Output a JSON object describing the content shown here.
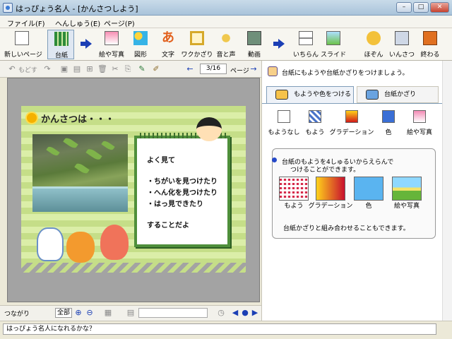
{
  "window": {
    "title": "はっぴょう名人 - [かんさつしよう]",
    "minimize": "–",
    "maximize": "□",
    "close": "✕"
  },
  "menu": [
    "ファイル(F)",
    "へんしゅう(E)",
    "ページ(P)"
  ],
  "toolbar": {
    "new_page": "新しいページ",
    "backing": "台紙",
    "pic_photo": "絵や写真",
    "shape": "図形",
    "text": "文字",
    "wakuframe": "ワクかざり",
    "sound": "音と声",
    "video": "動画",
    "list": "いちらん",
    "slide": "スライド",
    "save": "ほぞん",
    "print": "いんさつ",
    "quit": "終わる"
  },
  "subtoolbar": {
    "undo": "もどす",
    "page_counter": "3/16",
    "page_label": "ページ"
  },
  "slide": {
    "title": "かんさつは・・・",
    "lines": [
      "よく見て",
      "・ちがいを見つけたり",
      "・へん化を見つけたり",
      "・はっ見できたり",
      "することだよ"
    ]
  },
  "bottombar": {
    "connect": "つながり",
    "zoom": "全部"
  },
  "panel": {
    "header": "台紙にもようや台紙かざりをつけましょう。",
    "tabs": [
      "もようや色をつける",
      "台紙かざり"
    ],
    "options": [
      "もようなし",
      "もよう",
      "グラデーション",
      "色",
      "絵や写真"
    ],
    "info_line1": "台紙のもようを4しゅるいからえらんで",
    "info_line2": "つけることができます。",
    "swatches": [
      "もよう",
      "グラデーション",
      "色",
      "絵や写真"
    ],
    "note": "台紙かざりと組み合わせることもできます。"
  },
  "status": "はっぴょう名人になれるかな？",
  "colors": {
    "accent": "#1b3fb5",
    "board": "#4f8f3b",
    "stripe1": "#c5de88",
    "stripe2": "#dbeea8"
  }
}
